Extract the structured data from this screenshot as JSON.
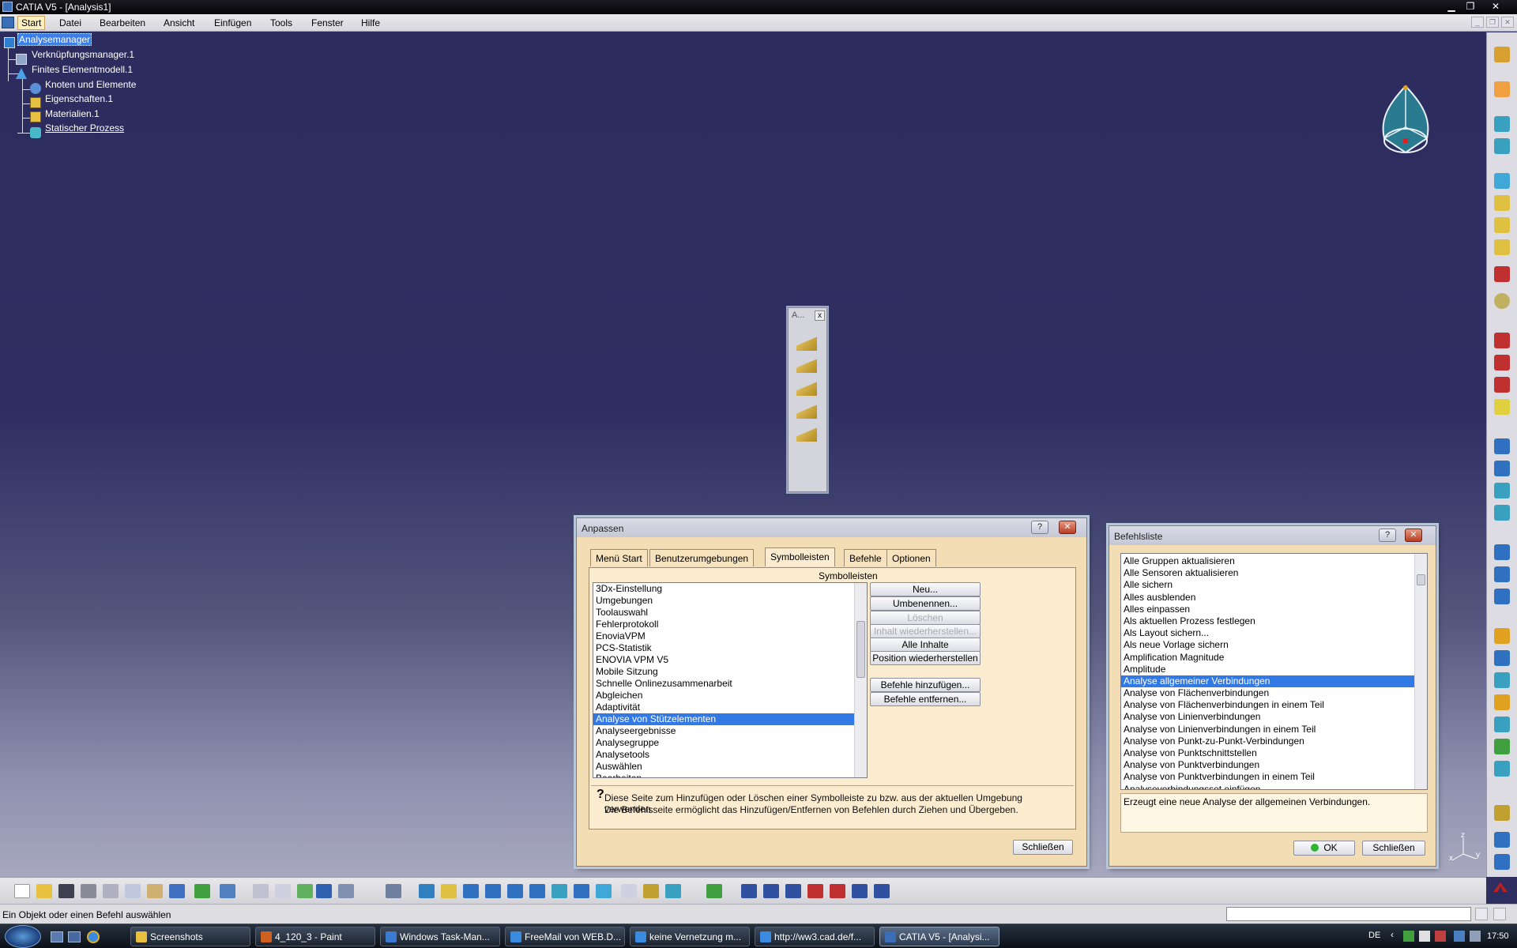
{
  "window": {
    "title": "CATIA V5 - [Analysis1]",
    "controls": {
      "minimize": "▁",
      "restore": "❐",
      "close": "✕"
    }
  },
  "menubar": {
    "items": [
      "Start",
      "Datei",
      "Bearbeiten",
      "Ansicht",
      "Einfügen",
      "Tools",
      "Fenster",
      "Hilfe"
    ],
    "doc_controls": {
      "minimize": "_",
      "restore": "❐",
      "close": "✕"
    }
  },
  "tree": {
    "root": "Analysemanager",
    "nodes": [
      "Verknüpfungsmanager.1",
      "Finites Elementmodell.1",
      "Knoten und Elemente",
      "Eigenschaften.1",
      "Materialien.1",
      "Statischer Prozess"
    ]
  },
  "floating_toolbar": {
    "title": "A...",
    "close": "x"
  },
  "anpassen": {
    "title": "Anpassen",
    "help": "?",
    "close": "✕",
    "tabs": [
      "Menü Start",
      "Benutzerumgebungen",
      "Symbolleisten",
      "Befehle",
      "Optionen"
    ],
    "active_tab": "Symbolleisten",
    "list_header": "Symbolleisten",
    "toolbars": [
      "3Dx-Einstellung",
      "Umgebungen",
      "Toolauswahl",
      "Fehlerprotokoll",
      "EnoviaVPM",
      "PCS-Statistik",
      "ENOVIA VPM V5",
      "Mobile Sitzung",
      "Schnelle Onlinezusammenarbeit",
      "Abgleichen",
      "Adaptivität",
      "Analyse von Stützelementen",
      "Analyseergebnisse",
      "Analysegruppe",
      "Analysetools",
      "Auswählen",
      "Bearbeiten"
    ],
    "selected": "Analyse von Stützelementen",
    "buttons": {
      "new": "Neu...",
      "rename": "Umbenennen...",
      "delete": "Löschen",
      "restore_content": "Inhalt wiederherstellen...",
      "restore_all": "Alle Inhalte wiederherstellen...",
      "restore_position": "Position wiederherstellen",
      "add_commands": "Befehle hinzufügen...",
      "remove_commands": "Befehle entfernen..."
    },
    "hint_line1": "Diese Seite zum Hinzufügen oder Löschen einer Symbolleiste zu bzw. aus der aktuellen Umgebung verwenden.",
    "hint_line2": "Die Befehlsseite ermöglicht das Hinzufügen/Entfernen von Befehlen durch Ziehen und Übergeben.",
    "close_button": "Schließen"
  },
  "befehlsliste": {
    "title": "Befehlsliste",
    "help": "?",
    "close": "✕",
    "items": [
      "Alle Gruppen aktualisieren",
      "Alle Sensoren aktualisieren",
      "Alle sichern",
      "Alles ausblenden",
      "Alles einpassen",
      "Als aktuellen Prozess festlegen",
      "Als Layout sichern...",
      "Als neue Vorlage sichern",
      "Amplification Magnitude",
      "Amplitude",
      "Analyse allgemeiner Verbindungen",
      "Analyse von Flächenverbindungen",
      "Analyse von Flächenverbindungen in einem Teil",
      "Analyse von Linienverbindungen",
      "Analyse von Linienverbindungen in einem Teil",
      "Analyse von Punkt-zu-Punkt-Verbindungen",
      "Analyse von Punktschnittstellen",
      "Analyse von Punktverbindungen",
      "Analyse von Punktverbindungen in einem Teil",
      "Analyseverbindungsset einfügen"
    ],
    "selected": "Analyse allgemeiner Verbindungen",
    "description": "Erzeugt eine neue Analyse der allgemeinen Verbindungen.",
    "ok": "OK",
    "close_button": "Schließen"
  },
  "statusbar": {
    "text": "Ein Objekt oder einen Befehl auswählen"
  },
  "catia_logo": "CATIA",
  "axis": {
    "z": "z",
    "y": "y",
    "x": "x"
  },
  "taskbar": {
    "tasks": [
      "Screenshots",
      "4_120_3 - Paint",
      "Windows Task-Man...",
      "FreeMail von WEB.D...",
      "keine Vernetzung m...",
      "http://ww3.cad.de/f...",
      "CATIA V5 - [Analysi..."
    ],
    "language": "DE",
    "clock": "17:50"
  },
  "colors": {
    "selection": "#3179e4",
    "dialog_bg": "#f3ddb5",
    "viewport_top": "#2c2c5e"
  }
}
